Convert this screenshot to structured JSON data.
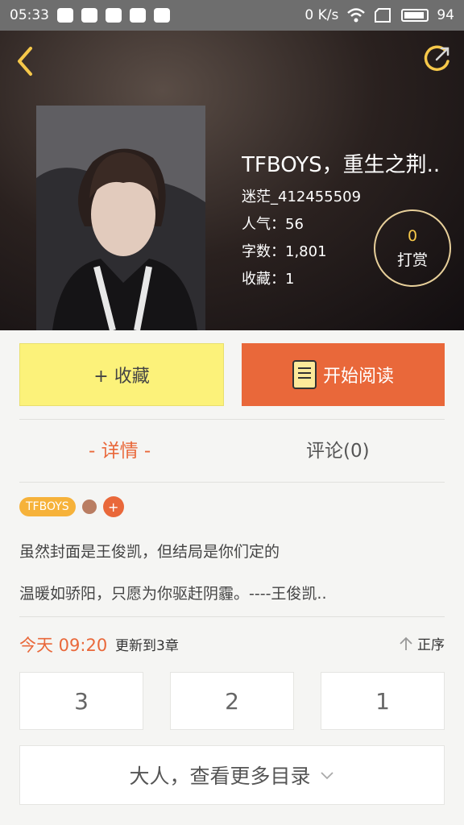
{
  "status_bar": {
    "time": "05:33",
    "net_speed": "0 K/s",
    "battery": "94"
  },
  "book": {
    "title": "TFBOYS，重生之荆..",
    "author": "迷茫_412455509",
    "popularity": "人气：56",
    "word_count": "字数：1,801",
    "favorites": "收藏：1"
  },
  "tip": {
    "count": "0",
    "label": "打赏"
  },
  "actions": {
    "collect_label": "+ 收藏",
    "read_label": "开始阅读"
  },
  "tabs": {
    "detail": "- 详情 -",
    "comments": "评论(0)"
  },
  "tags": {
    "tag1": "TFBOYS",
    "add": "+"
  },
  "description": {
    "line1": "虽然封面是王俊凯，但结局是你们定的",
    "line2": "温暖如骄阳，只愿为你驱赶阴霾。----王俊凯.."
  },
  "update": {
    "time": "今天 09:20",
    "text": "更新到3章",
    "order_label": "正序"
  },
  "chapters": [
    "3",
    "2",
    "1"
  ],
  "more_label": "大人，查看更多目录",
  "colors": {
    "accent": "#e9683a",
    "collect_bg": "#fcf27a",
    "tag": "#f6b23a"
  }
}
